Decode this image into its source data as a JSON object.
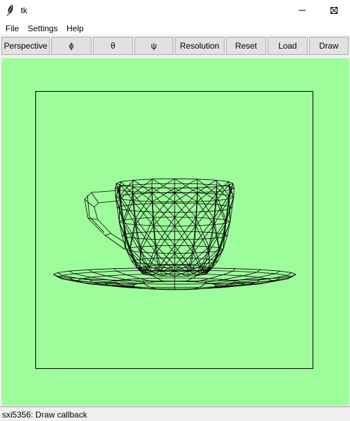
{
  "window": {
    "title": "tk",
    "controls": {
      "minimize_icon": "minimize-icon",
      "maximize_icon": "maximize-icon",
      "close_icon": "close-icon"
    }
  },
  "menubar": {
    "items": [
      {
        "label": "File"
      },
      {
        "label": "Settings"
      },
      {
        "label": "Help"
      }
    ]
  },
  "toolbar": {
    "buttons": [
      {
        "label": "Perspective"
      },
      {
        "label": "ϕ"
      },
      {
        "label": "θ"
      },
      {
        "label": "ψ"
      },
      {
        "label": "Resolution"
      },
      {
        "label": "Reset"
      },
      {
        "label": "Load"
      },
      {
        "label": "Draw"
      }
    ]
  },
  "canvas": {
    "background_color": "#9dfd9b",
    "line_color": "#000000",
    "drawing": "wireframe-teacup-with-saucer"
  },
  "status": {
    "text": "sxi5356: Draw callback"
  }
}
